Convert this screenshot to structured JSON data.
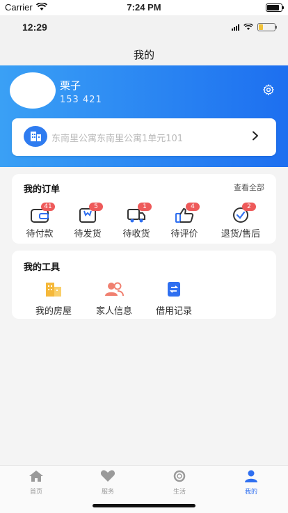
{
  "status_bar": {
    "carrier": "Carrier",
    "time": "7:24 PM"
  },
  "inner_status": {
    "time": "12:29"
  },
  "nav": {
    "title": "我的"
  },
  "profile": {
    "name": "栗子",
    "phone": "153          421"
  },
  "address": {
    "text": "东南里公寓东南里公寓1单元101"
  },
  "orders": {
    "title": "我的订单",
    "view_all": "查看全部",
    "items": [
      {
        "label": "待付款",
        "badge": "41",
        "icon": "wallet-icon"
      },
      {
        "label": "待发货",
        "badge": "5",
        "icon": "box-icon"
      },
      {
        "label": "待收货",
        "badge": "1",
        "icon": "truck-icon"
      },
      {
        "label": "待评价",
        "badge": "4",
        "icon": "thumbs-up-icon"
      },
      {
        "label": "退货/售后",
        "badge": "2",
        "icon": "check-circle-icon"
      }
    ]
  },
  "tools": {
    "title": "我的工具",
    "items": [
      {
        "label": "我的房屋",
        "icon": "building-icon"
      },
      {
        "label": "家人信息",
        "icon": "family-icon"
      },
      {
        "label": "借用记录",
        "icon": "record-icon"
      }
    ]
  },
  "tabs": [
    {
      "label": "首页",
      "icon": "home-icon"
    },
    {
      "label": "服务",
      "icon": "heart-icon"
    },
    {
      "label": "生活",
      "icon": "life-icon"
    },
    {
      "label": "我的",
      "icon": "user-icon",
      "active": true
    }
  ],
  "colors": {
    "primary": "#2f6ff0",
    "badge": "#ee5a5a",
    "tool_orange": "#f5b83a",
    "tool_coral": "#f08070"
  }
}
